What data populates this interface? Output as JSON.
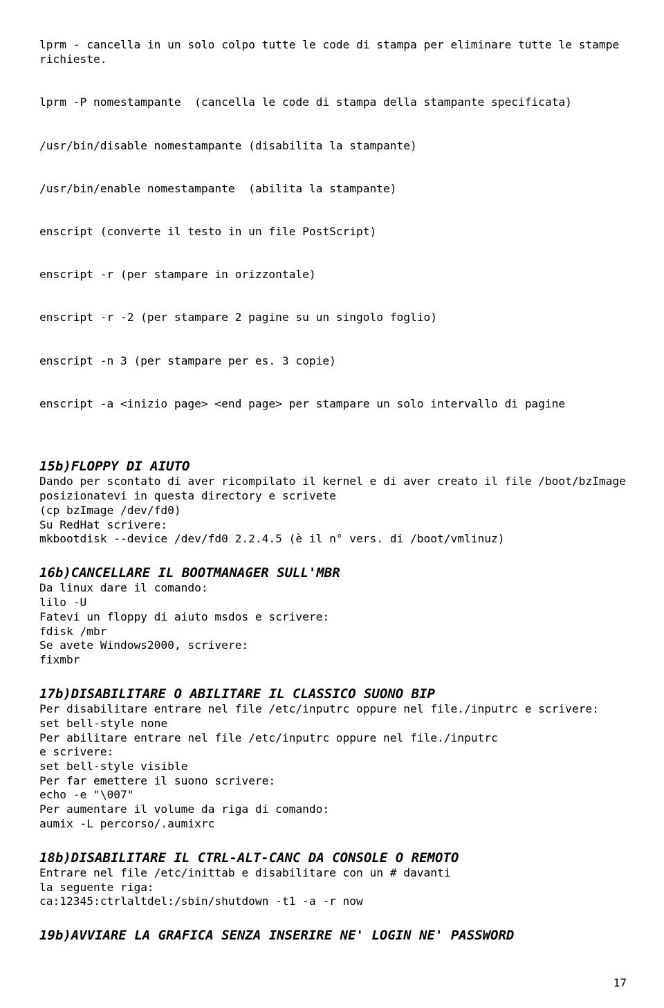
{
  "sec14_tail": [
    "lprm - cancella in un solo colpo tutte le code di stampa per eliminare tutte le stampe richieste.",
    "lprm -P nomestampante  (cancella le code di stampa della stampante specificata)",
    "/usr/bin/disable nomestampante (disabilita la stampante)",
    "/usr/bin/enable nomestampante  (abilita la stampante)",
    "enscript (converte il testo in un file PostScript)",
    "enscript -r (per stampare in orizzontale)",
    "enscript -r -2 (per stampare 2 pagine su un singolo foglio)",
    "enscript -n 3 (per stampare per es. 3 copie)",
    "enscript -a <inizio page> <end page> per stampare un solo intervallo di pagine"
  ],
  "sec15": {
    "heading": "15b)FLOPPY DI AIUTO",
    "lines": [
      "Dando per scontato di aver ricompilato il kernel e di aver creato il file /boot/bzImage posizionatevi in questa directory e scrivete",
      "(cp bzImage /dev/fd0)",
      "Su RedHat scrivere:",
      "mkbootdisk --device /dev/fd0 2.2.4.5 (è il n° vers. di /boot/vmlinuz)"
    ]
  },
  "sec16": {
    "heading": "16b)CANCELLARE IL BOOTMANAGER SULL'MBR",
    "lines": [
      "Da linux dare il comando:",
      "lilo -U",
      "Fatevi un floppy di aiuto msdos e scrivere:",
      "fdisk /mbr",
      "Se avete Windows2000, scrivere:",
      "fixmbr"
    ]
  },
  "sec17": {
    "heading": "17b)DISABILITARE O ABILITARE IL CLASSICO SUONO BIP",
    "lines": [
      "Per disabilitare entrare nel file /etc/inputrc oppure nel file./inputrc e scrivere:",
      "set bell-style none",
      "",
      "Per abilitare entrare nel file /etc/inputrc oppure nel file./inputrc",
      "e scrivere:",
      "set bell-style visible",
      "",
      "Per far emettere il suono scrivere:",
      "echo -e \"\\007\"",
      "Per aumentare il volume da riga di comando:",
      "aumix -L percorso/.aumixrc"
    ]
  },
  "sec18": {
    "heading": "18b)DISABILITARE IL CTRL-ALT-CANC DA CONSOLE O REMOTO",
    "lines": [
      "Entrare nel file /etc/inittab e disabilitare con un # davanti",
      "la seguente riga:",
      "ca:12345:ctrlaltdel:/sbin/shutdown -t1 -a -r now"
    ]
  },
  "sec19": {
    "heading": "19b)AVVIARE LA GRAFICA SENZA INSERIRE NE' LOGIN NE' PASSWORD"
  },
  "page_number": "17"
}
